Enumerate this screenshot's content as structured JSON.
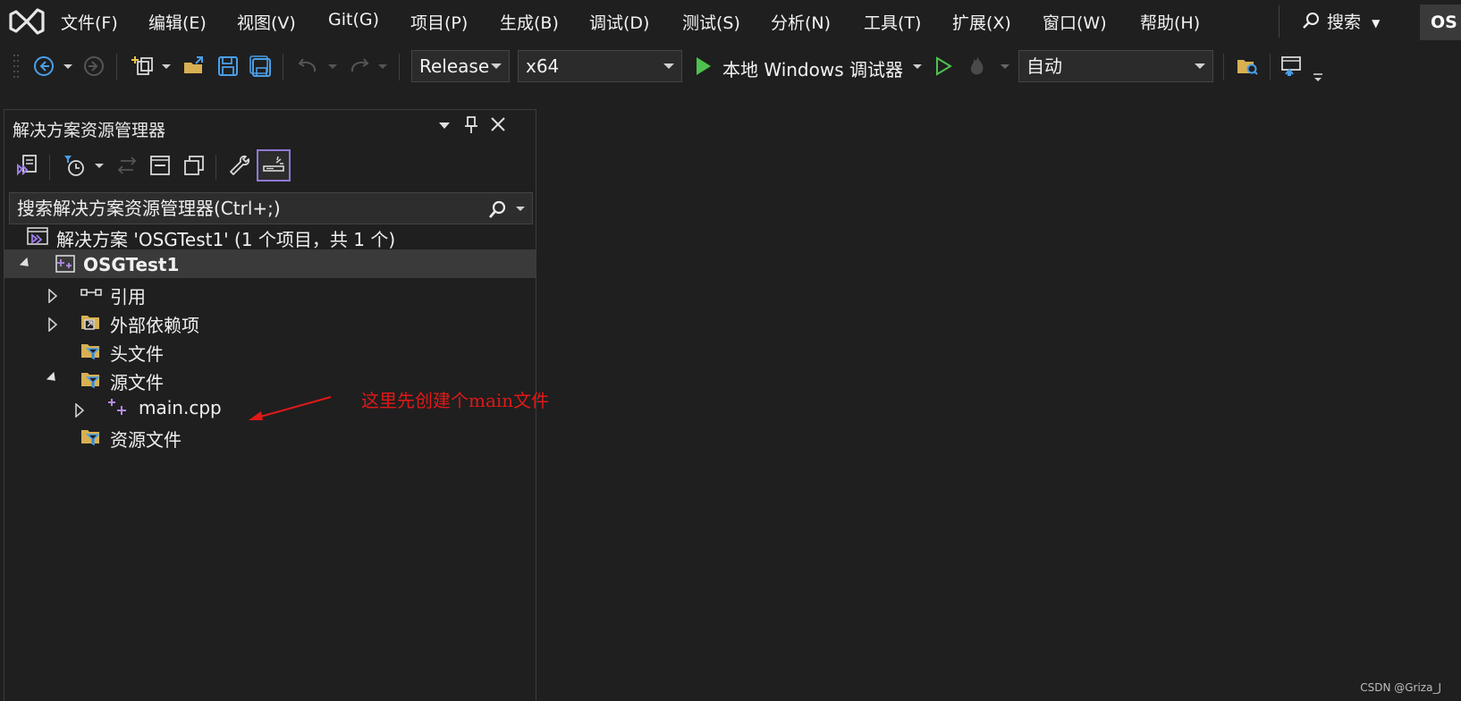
{
  "menu": {
    "items": [
      "文件(F)",
      "编辑(E)",
      "视图(V)",
      "Git(G)",
      "项目(P)",
      "生成(B)",
      "调试(D)",
      "测试(S)",
      "分析(N)",
      "工具(T)",
      "扩展(X)",
      "窗口(W)",
      "帮助(H)"
    ],
    "search_label": "搜索",
    "solution_badge": "OS"
  },
  "toolbar": {
    "configuration": "Release",
    "platform": "x64",
    "run_target": "本地 Windows 调试器",
    "debug_mode": "自动"
  },
  "solution_explorer": {
    "title": "解决方案资源管理器",
    "search_placeholder": "搜索解决方案资源管理器(Ctrl+;)",
    "solution_label": "解决方案 'OSGTest1' (1 个项目，共 1 个)",
    "project": "OSGTest1",
    "nodes": {
      "references": "引用",
      "external_deps": "外部依赖项",
      "header_files": "头文件",
      "source_files": "源文件",
      "main_cpp": "main.cpp",
      "resource_files": "资源文件"
    }
  },
  "annotation": "这里先创建个main文件",
  "watermark": "CSDN @Griza_J",
  "colors": {
    "background": "#1f1f1f",
    "accent_purple": "#8f79d8",
    "run_green": "#4ec24e",
    "folder_yellow": "#d8b052",
    "annotation_red": "#e01818"
  }
}
